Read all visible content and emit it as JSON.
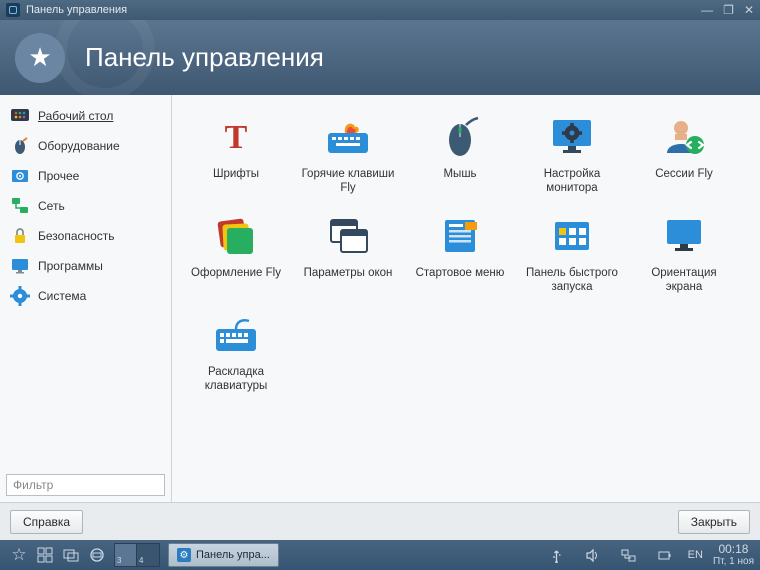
{
  "window": {
    "title": "Панель управления"
  },
  "banner": {
    "title": "Панель управления"
  },
  "sidebar": {
    "categories": [
      {
        "id": "desktop",
        "label": "Рабочий стол",
        "active": true
      },
      {
        "id": "hardware",
        "label": "Оборудование"
      },
      {
        "id": "other",
        "label": "Прочее"
      },
      {
        "id": "network",
        "label": "Сеть"
      },
      {
        "id": "security",
        "label": "Безопасность"
      },
      {
        "id": "programs",
        "label": "Программы"
      },
      {
        "id": "system",
        "label": "Система"
      }
    ],
    "filter_placeholder": "Фильтр"
  },
  "items": [
    {
      "id": "fonts",
      "label": "Шрифты"
    },
    {
      "id": "hotkeys",
      "label": "Горячие клавиши Fly"
    },
    {
      "id": "mouse",
      "label": "Мышь"
    },
    {
      "id": "monitor",
      "label": "Настройка монитора"
    },
    {
      "id": "sessions",
      "label": "Сессии Fly"
    },
    {
      "id": "theme",
      "label": "Оформление Fly"
    },
    {
      "id": "windowparams",
      "label": "Параметры окон"
    },
    {
      "id": "startmenu",
      "label": "Стартовое меню"
    },
    {
      "id": "quicklaunch",
      "label": "Панель быстрого запуска"
    },
    {
      "id": "orientation",
      "label": "Ориентация экрана"
    },
    {
      "id": "keyboard",
      "label": "Раскладка клавиатуры"
    }
  ],
  "footer": {
    "help": "Справка",
    "close": "Закрыть"
  },
  "taskbar": {
    "desktops": [
      "3",
      "4"
    ],
    "active_task": "Панель упра...",
    "lang": "EN",
    "time": "00:18",
    "date": "Пт, 1 ноя"
  },
  "colors": {
    "accent": "#2c8ed9",
    "orange": "#f39c12",
    "green": "#27ae60",
    "red": "#c0392b",
    "dark": "#2f3a48"
  }
}
